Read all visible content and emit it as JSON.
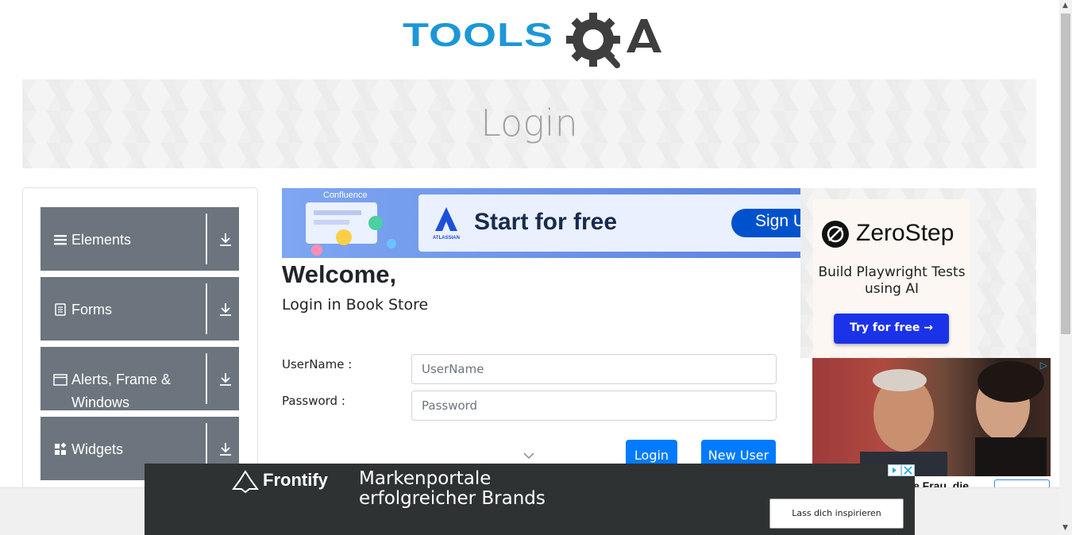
{
  "logo": {
    "text_tools": "TOOLS",
    "text_qa": "A"
  },
  "banner": {
    "title": "Login"
  },
  "sidebar": {
    "groups": [
      {
        "label": "Elements",
        "icon": "hamburger-icon"
      },
      {
        "label": "Forms",
        "icon": "document-icon"
      },
      {
        "label": "Alerts, Frame & Windows",
        "icon": "window-icon"
      },
      {
        "label": "Widgets",
        "icon": "widgets-icon"
      }
    ]
  },
  "ad_top": {
    "brand": "Confluence",
    "company": "ATLASSIAN",
    "headline": "Start for free",
    "button": "Sign U"
  },
  "login": {
    "welcome": "Welcome,",
    "subtitle": "Login in Book Store",
    "username_label": "UserName :",
    "username_placeholder": "UserName",
    "password_label": "Password :",
    "password_placeholder": "Password",
    "login_button": "Login",
    "new_user_button": "New User"
  },
  "ad_right": {
    "brand": "ZeroStep",
    "tagline": "Build Playwright Tests using AI",
    "button": "Try for free →"
  },
  "ad_photo": {
    "caption": "e Frau, die"
  },
  "ad_bottom": {
    "brand": "Frontify",
    "copy": "Markenportale erfolgreicher Brands",
    "button": "Lass dich inspirieren"
  },
  "colors": {
    "accent": "#007bff",
    "nav": "#6c757d",
    "logo_blue": "#1c97d6",
    "logo_gray": "#3e3e3e"
  }
}
